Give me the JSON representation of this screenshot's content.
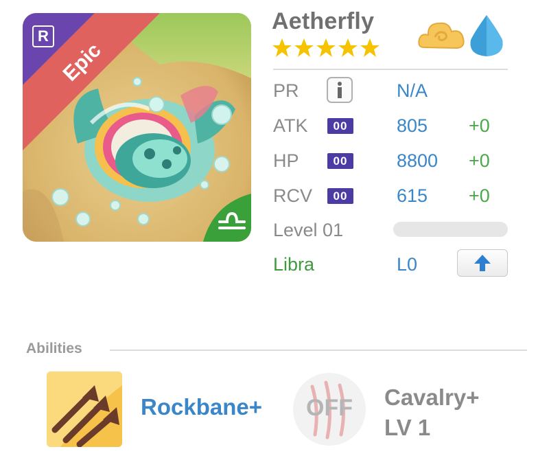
{
  "card": {
    "name": "Aetherfly",
    "rarity": "Epic",
    "rarity_color": "#e0625f",
    "rank_badge": "R",
    "stars": 5,
    "star_color": "#f5c300",
    "elements": [
      "cloud-icon",
      "water-drop-icon"
    ],
    "zodiac_icon": "libra-icon"
  },
  "stats": {
    "pr": {
      "label": "PR",
      "value": "N/A"
    },
    "atk": {
      "label": "ATK",
      "badge": "00",
      "value": "805",
      "bonus": "+0"
    },
    "hp": {
      "label": "HP",
      "badge": "00",
      "value": "8800",
      "bonus": "+0"
    },
    "rcv": {
      "label": "RCV",
      "badge": "00",
      "value": "615",
      "bonus": "+0"
    }
  },
  "level": {
    "label": "Level 01",
    "progress": 0
  },
  "sign": {
    "label": "Libra",
    "level": "L0"
  },
  "abilities": {
    "title": "Abilities",
    "skill": {
      "name": "Rockbane+",
      "icon": "triple-arrow-icon"
    },
    "toggle": {
      "label": "OFF",
      "icon": "claw-marks-icon"
    },
    "leader": {
      "line1": "Cavalry+",
      "line2": "LV 1"
    }
  },
  "colors": {
    "value_blue": "#3b86c8",
    "bonus_green": "#4aa84a",
    "badge_purple": "#4b3ba3",
    "sign_green": "#3f9a3f"
  }
}
